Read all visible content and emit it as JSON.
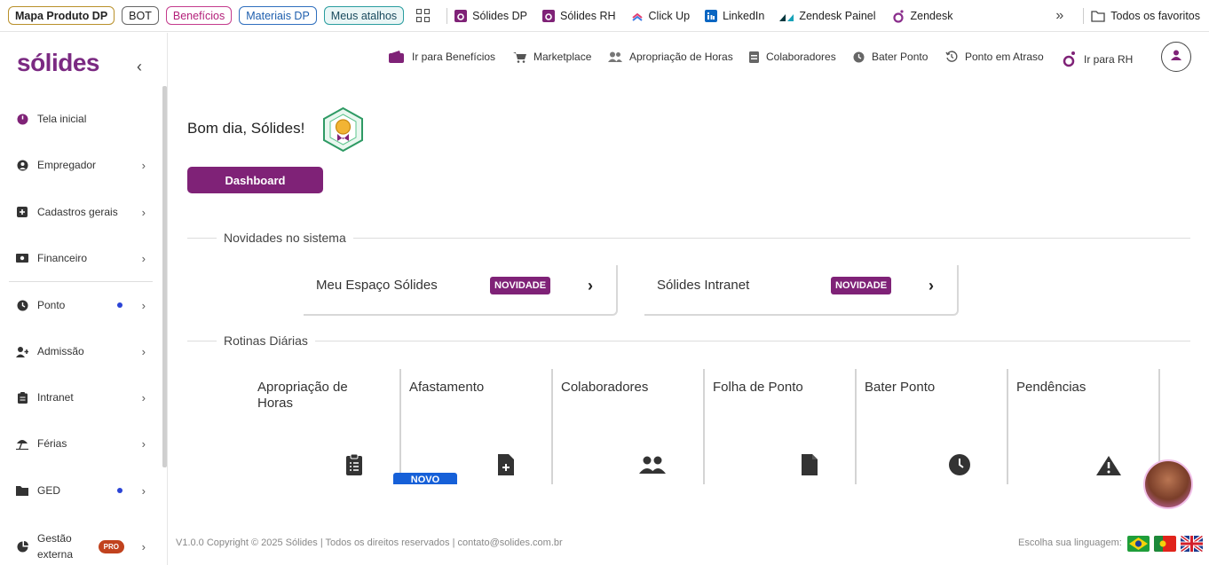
{
  "bookmarks": {
    "chips": [
      "Mapa Produto DP",
      "BOT",
      "Benefícios",
      "Materiais DP",
      "Meus atalhos"
    ],
    "links": [
      "Sólides DP",
      "Sólides RH",
      "Click Up",
      "LinkedIn",
      "Zendesk Painel",
      "Zendesk"
    ],
    "all_bookmarks": "Todos os favoritos"
  },
  "sidebar": {
    "logo": "sólides",
    "items": [
      {
        "label": "Tela inicial"
      },
      {
        "label": "Empregador"
      },
      {
        "label": "Cadastros gerais"
      },
      {
        "label": "Financeiro"
      },
      {
        "label": "Ponto"
      },
      {
        "label": "Admissão"
      },
      {
        "label": "Intranet"
      },
      {
        "label": "Férias"
      },
      {
        "label": "GED"
      },
      {
        "label": "Gestão externa",
        "badge": "PRO"
      }
    ]
  },
  "topnav": {
    "items": [
      "Ir para Benefícios",
      "Marketplace",
      "Apropriação de Horas",
      "Colaboradores",
      "Bater Ponto",
      "Ponto em Atraso",
      "Ir para RH"
    ]
  },
  "main": {
    "greeting": "Bom dia, Sólides!",
    "dashboard_button": "Dashboard",
    "news_title": "Novidades no sistema",
    "news": [
      {
        "title": "Meu Espaço Sólides",
        "badge": "NOVIDADE"
      },
      {
        "title": "Sólides Intranet",
        "badge": "NOVIDADE"
      }
    ],
    "routines_title": "Rotinas Diárias",
    "routines": [
      {
        "title": "Apropriação de Horas"
      },
      {
        "title": "Afastamento",
        "badge": "NOVO"
      },
      {
        "title": "Colaboradores"
      },
      {
        "title": "Folha de Ponto"
      },
      {
        "title": "Bater Ponto"
      },
      {
        "title": "Pendências"
      }
    ]
  },
  "footer": {
    "copyright": "V1.0.0 Copyright © 2025 Sólides | Todos os direitos reservados | contato@solides.com.br",
    "language_label": "Escolha sua linguagem:"
  },
  "colors": {
    "brand": "#7f2277",
    "novo_badge": "#1660d8",
    "pro_badge": "#c1421e"
  }
}
